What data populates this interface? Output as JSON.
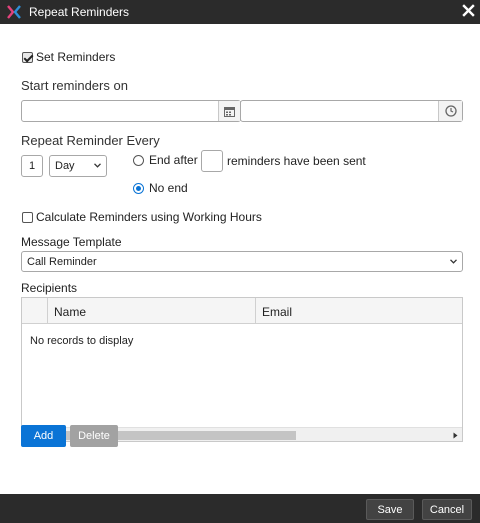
{
  "dialog": {
    "title": "Repeat Reminders"
  },
  "form": {
    "set_reminders_label": "Set Reminders",
    "set_reminders_checked": true,
    "start_label": "Start reminders on",
    "date_value": "",
    "time_value": "",
    "repeat_label": "Repeat Reminder Every",
    "interval_value": "1",
    "interval_unit": "Day",
    "end_after_label": "End after",
    "end_after_value": "",
    "reminders_sent_label": "reminders have been sent",
    "no_end_label": "No end",
    "no_end_selected": true,
    "working_hours_label": "Calculate Reminders using Working Hours",
    "working_hours_checked": false,
    "template_label": "Message Template",
    "template_value": "Call Reminder",
    "recipients_label": "Recipients"
  },
  "recipients_grid": {
    "columns": [
      "Name",
      "Email"
    ],
    "empty_message": "No records to display"
  },
  "buttons": {
    "add": "Add",
    "delete": "Delete",
    "save": "Save",
    "cancel": "Cancel"
  },
  "icons": {
    "logo": "app-logo-icon",
    "close": "close-icon",
    "calendar": "calendar-icon",
    "clock": "clock-icon"
  },
  "colors": {
    "titlebar": "#2b2b2b",
    "primary": "#0a74d6",
    "secondary_button": "#a2a2a2",
    "logo_pink": "#e4427c",
    "logo_blue": "#2f8fd8"
  }
}
